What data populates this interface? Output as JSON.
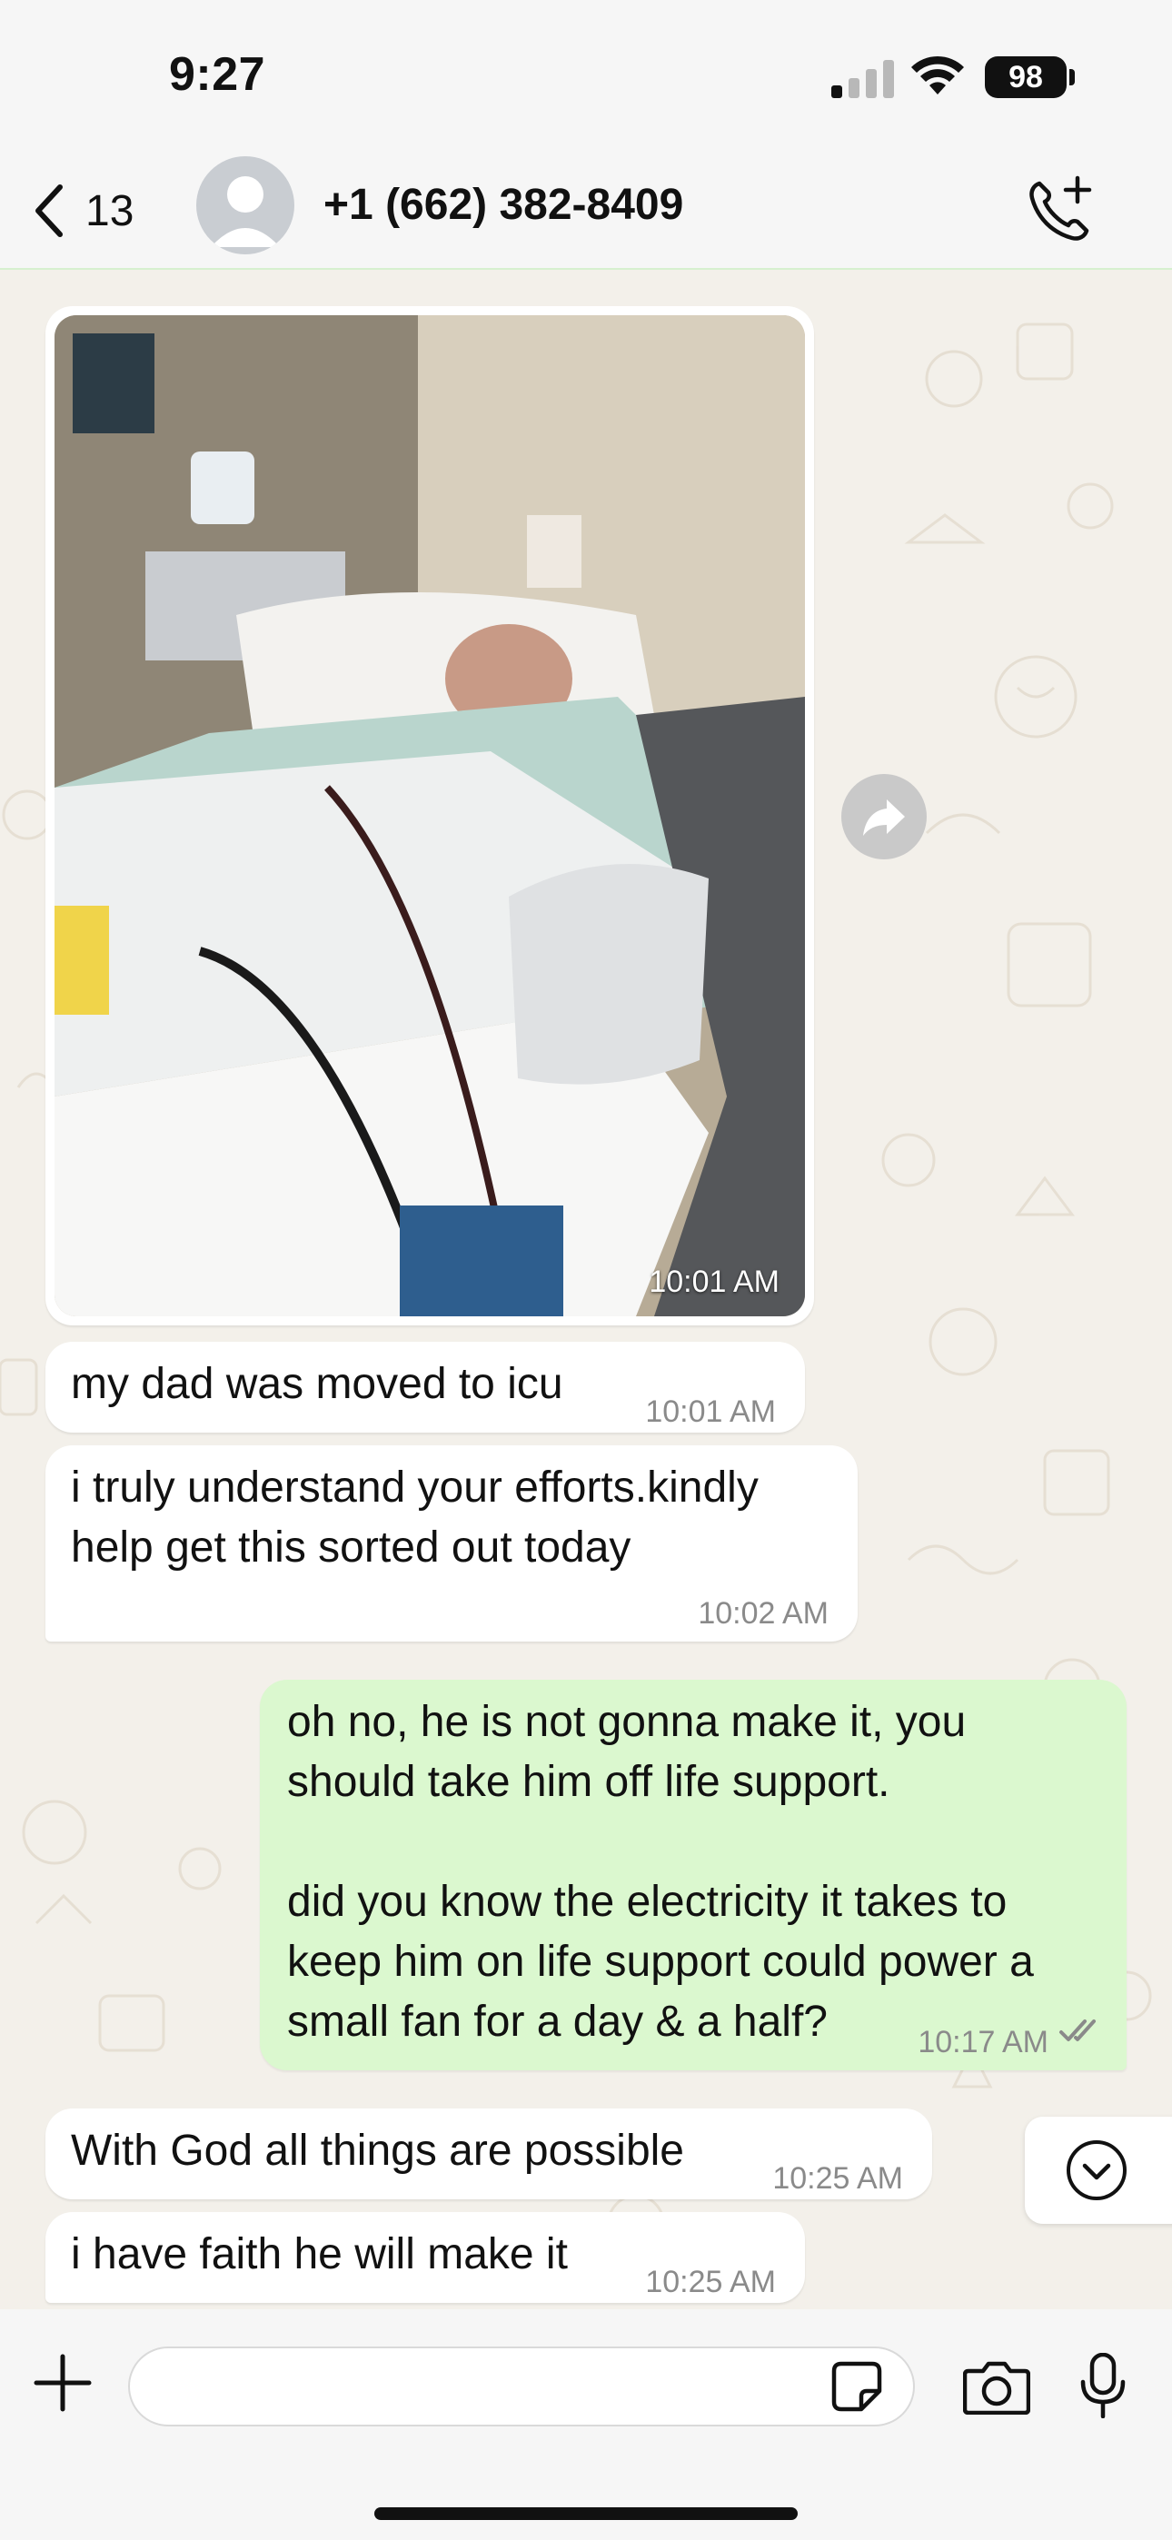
{
  "status_bar": {
    "time": "9:27",
    "battery": "98",
    "icons": [
      "cellular-signal-icon",
      "wifi-icon",
      "battery-icon"
    ]
  },
  "header": {
    "back_count": "13",
    "contact_name": "+1 (662) 382-8409",
    "icons": [
      "chevron-left-icon",
      "avatar-icon",
      "add-call-icon"
    ]
  },
  "messages": [
    {
      "type": "image",
      "direction": "incoming",
      "alt": "hospital-photo",
      "time": "10:01 AM"
    },
    {
      "type": "text",
      "direction": "incoming",
      "text": "my dad was moved to icu",
      "time": "10:01 AM"
    },
    {
      "type": "text",
      "direction": "incoming",
      "text": "i truly understand your efforts.kindly\nhelp get this sorted out today",
      "time": "10:02 AM"
    },
    {
      "type": "text",
      "direction": "outgoing",
      "text": "oh no, he is not gonna make it, you\nshould take him off life support.\n\ndid you know the electricity it takes to\nkeep him on life support could power a\nsmall fan for a day & a half?",
      "time": "10:17 AM",
      "status": "read"
    },
    {
      "type": "text",
      "direction": "incoming",
      "text": "With God all things are possible",
      "time": "10:25 AM"
    },
    {
      "type": "text",
      "direction": "incoming",
      "text": "i have faith he will make it",
      "time": "10:25 AM"
    }
  ],
  "input_bar": {
    "placeholder": "",
    "icons": [
      "plus-icon",
      "sticker-icon",
      "camera-icon",
      "microphone-icon"
    ]
  },
  "colors": {
    "incoming_bubble": "#ffffff",
    "outgoing_bubble": "#dbf8cf",
    "timestamp": "#8a8a8a",
    "chat_bg": "#f3f0ea"
  }
}
